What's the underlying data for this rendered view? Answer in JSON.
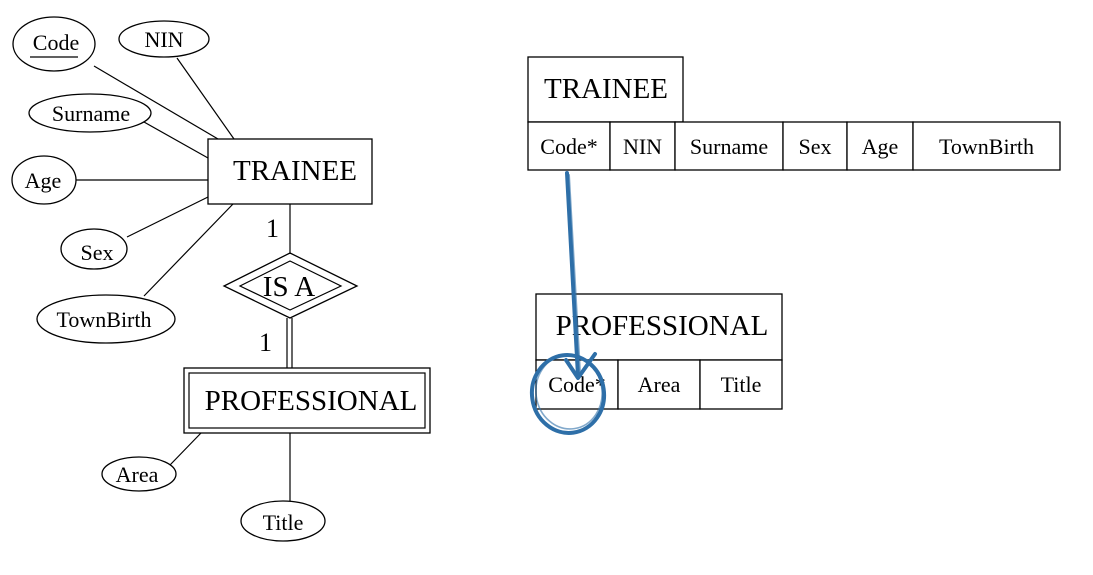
{
  "er_diagram": {
    "entities": {
      "trainee": {
        "label": "TRAINEE",
        "type": "strong"
      },
      "professional": {
        "label": "PROFESSIONAL",
        "type": "weak"
      }
    },
    "relationship": {
      "label": "IS A",
      "type": "identifying"
    },
    "cardinality": {
      "trainee_side": "1",
      "professional_side": "1"
    },
    "trainee_attributes": [
      {
        "label": "Code",
        "key": true
      },
      {
        "label": "NIN",
        "key": false
      },
      {
        "label": "Surname",
        "key": false
      },
      {
        "label": "Age",
        "key": false
      },
      {
        "label": "Sex",
        "key": false
      },
      {
        "label": "TownBirth",
        "key": false
      }
    ],
    "professional_attributes": [
      {
        "label": "Area"
      },
      {
        "label": "Title"
      }
    ]
  },
  "relational_schema": {
    "tables": [
      {
        "name": "TRAINEE",
        "columns": [
          "Code*",
          "NIN",
          "Surname",
          "Sex",
          "Age",
          "TownBirth"
        ]
      },
      {
        "name": "PROFESSIONAL",
        "columns": [
          "Code*",
          "Area",
          "Title"
        ]
      }
    ],
    "annotation": {
      "type": "hand-drawn arrow and circle",
      "from": "TRAINEE.Code*",
      "to": "PROFESSIONAL.Code*",
      "color": "#2e6fa8"
    }
  }
}
